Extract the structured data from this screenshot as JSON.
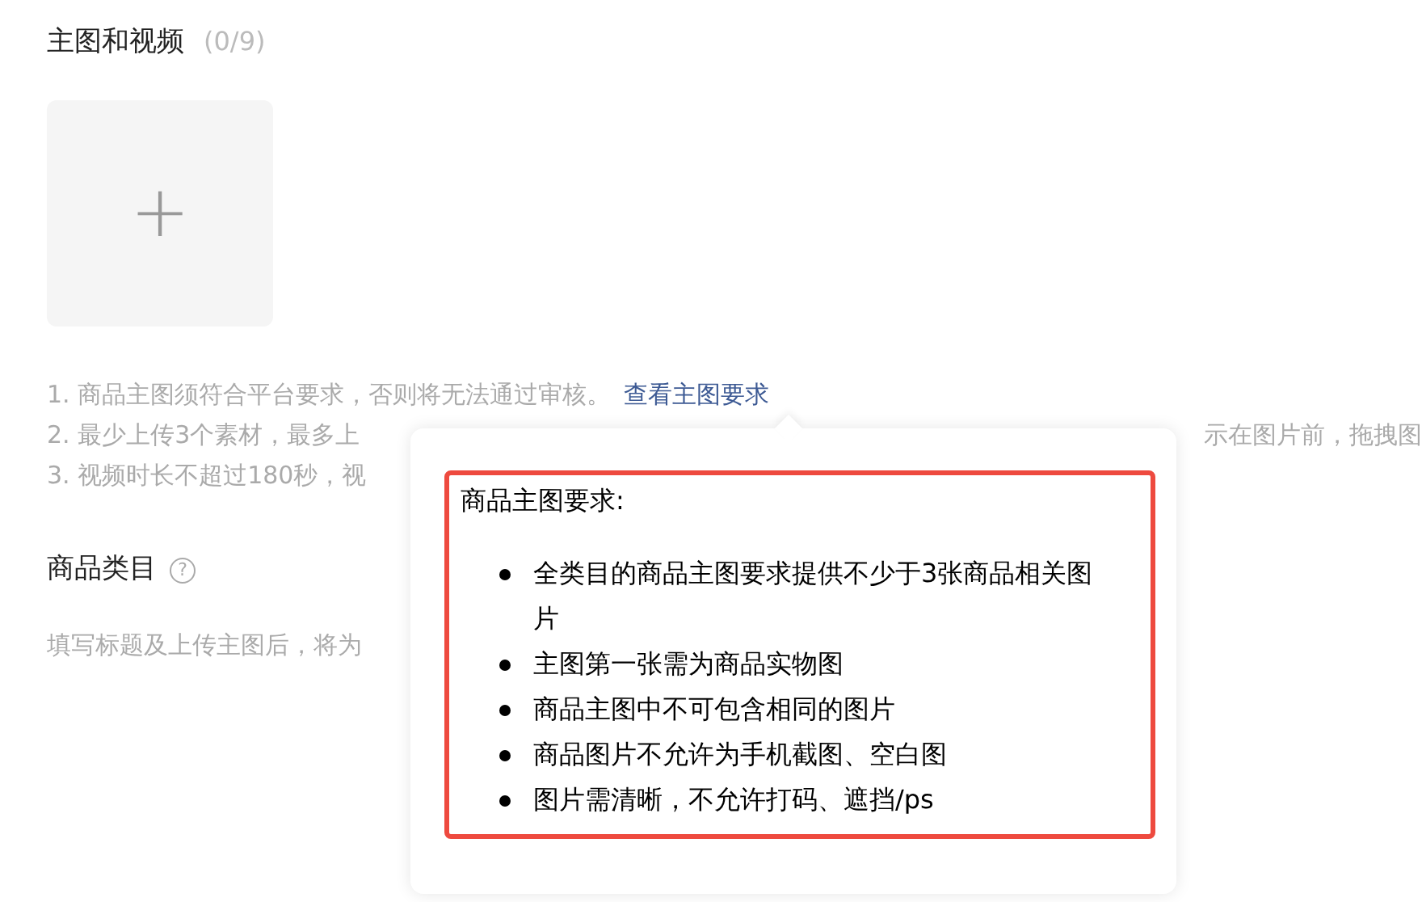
{
  "media_section": {
    "title": "主图和视频",
    "count": "(0/9)",
    "upload_symbol": "+"
  },
  "notes": [
    {
      "kind": "full",
      "text": "1. 商品主图须符合平台要求，否则将无法通过审核。",
      "link": "查看主图要求"
    },
    {
      "kind": "split",
      "text": "2. 最少上传3个素材，最多上",
      "text_right": "示在图片前，拖拽图"
    },
    {
      "kind": "full",
      "text": "3. 视频时长不超过180秒，视"
    }
  ],
  "category_section": {
    "title": "商品类目",
    "help_symbol": "?",
    "hint": "填写标题及上传主图后，将为"
  },
  "popover": {
    "title": "商品主图要求:",
    "items": [
      "全类目的商品主图要求提供不少于3张商品相关图片",
      "主图第一张需为商品实物图",
      "商品主图中不可包含相同的图片",
      "商品图片不允许为手机截图、空白图",
      "图片需清晰，不允许打码、遮挡/ps"
    ]
  }
}
